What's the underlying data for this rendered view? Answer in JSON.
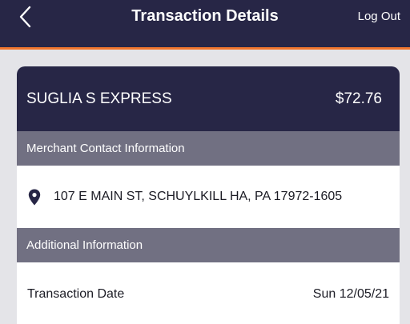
{
  "header": {
    "title": "Transaction Details",
    "back_icon": "chevron-left-icon",
    "logout_label": "Log Out"
  },
  "transaction": {
    "merchant_name": "SUGLIA S EXPRESS",
    "amount": "$72.76"
  },
  "sections": {
    "merchant_contact_title": "Merchant Contact Information",
    "additional_info_title": "Additional Information"
  },
  "merchant_contact": {
    "address_icon": "map-pin-icon",
    "address": "107 E MAIN ST, SCHUYLKILL HA, PA 17972-1605"
  },
  "additional_info": {
    "rows": [
      {
        "label": "Transaction Date",
        "value": "Sun 12/05/21"
      }
    ]
  },
  "colors": {
    "brand_navy": "#272646",
    "accent_orange": "#f0762e",
    "section_gray": "#717082",
    "background": "#e4e4e8"
  }
}
